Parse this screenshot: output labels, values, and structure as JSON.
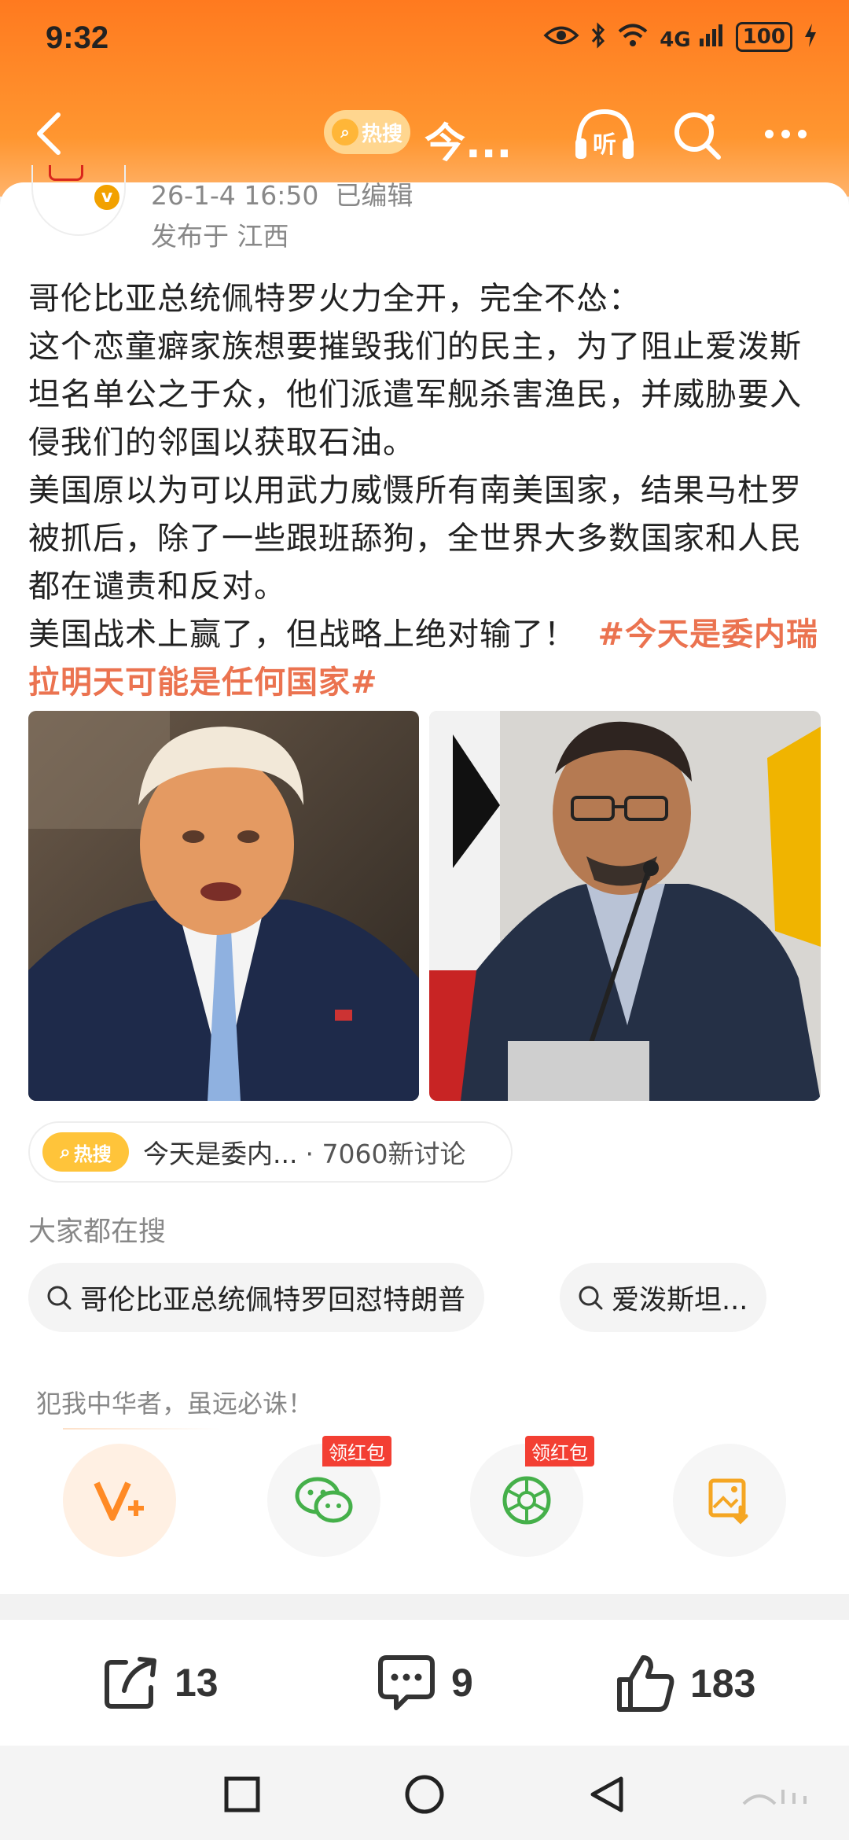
{
  "status": {
    "time": "9:32",
    "battery": "100",
    "network": "4G"
  },
  "nav": {
    "hot_label": "热搜",
    "title": "今...",
    "listen_label": "听"
  },
  "post": {
    "date": "26-1-4 16:50",
    "edited": "已编辑",
    "location": "发布于 江西",
    "lines": [
      "哥伦比亚总统佩特罗火力全开，完全不怂：",
      "这个恋童癖家族想要摧毁我们的民主，为了阻止爱泼斯坦名单公之于众，他们派遣军舰杀害渔民，并威胁要入侵我们的邻国以获取石油。",
      "美国原以为可以用武力威慑所有南美国家，结果马杜罗被抓后，除了一些跟班舔狗，全世界大多数国家和人民都在谴责和反对。"
    ],
    "last_line": "美国战术上赢了，但战略上绝对输了！",
    "hashtag": "#今天是委内瑞拉明天可能是任何国家#"
  },
  "hot": {
    "logo": "热搜",
    "topic": "今天是委内...",
    "count": "· 7060新讨论"
  },
  "search": {
    "title": "大家都在搜",
    "chips": [
      "哥伦比亚总统佩特罗回怼特朗普",
      "爱泼斯坦..."
    ]
  },
  "quote": "犯我中华者，虽远必诛！",
  "share": {
    "redpack_label": "领红包"
  },
  "actions": {
    "share_count": "13",
    "comment_count": "9",
    "like_count": "183"
  },
  "colors": {
    "accent": "#ff8a25",
    "hashtag": "#eb7350",
    "redpack": "#f33f33"
  }
}
